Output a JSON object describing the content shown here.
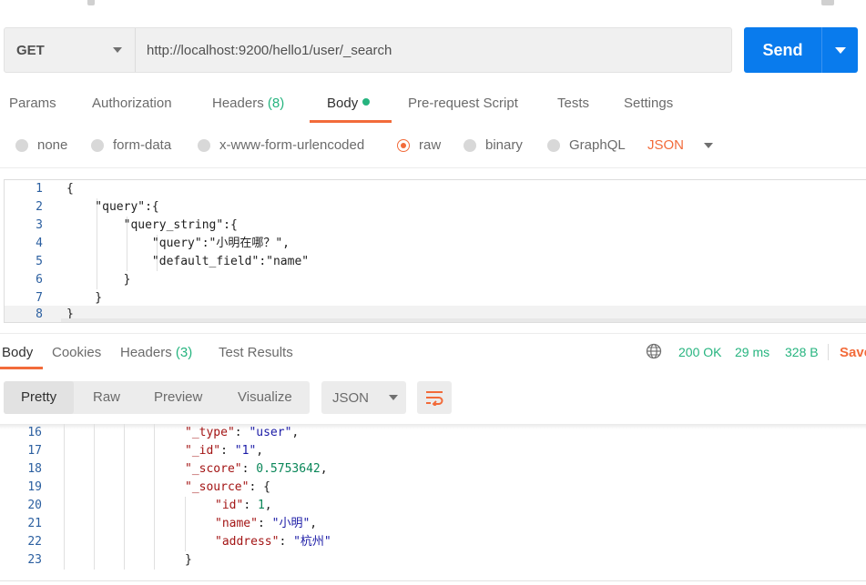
{
  "request": {
    "method": "GET",
    "url": "http://localhost:9200/hello1/user/_search",
    "send_label": "Send"
  },
  "request_tabs": [
    {
      "label": "Params"
    },
    {
      "label": "Authorization"
    },
    {
      "label": "Headers",
      "count": "(8)"
    },
    {
      "label": "Body",
      "active": true
    },
    {
      "label": "Pre-request Script"
    },
    {
      "label": "Tests"
    },
    {
      "label": "Settings"
    }
  ],
  "body_types": [
    {
      "label": "none"
    },
    {
      "label": "form-data"
    },
    {
      "label": "x-www-form-urlencoded"
    },
    {
      "label": "raw",
      "selected": true
    },
    {
      "label": "binary"
    },
    {
      "label": "GraphQL"
    }
  ],
  "body_format": "JSON",
  "request_body": [
    {
      "n": "1",
      "text": "{"
    },
    {
      "n": "2",
      "text": "    \"query\":{"
    },
    {
      "n": "3",
      "text": "        \"query_string\":{"
    },
    {
      "n": "4",
      "text": "            \"query\":\"小明在哪？\","
    },
    {
      "n": "5",
      "text": "            \"default_field\":\"name\""
    },
    {
      "n": "6",
      "text": "        }"
    },
    {
      "n": "7",
      "text": "    }"
    },
    {
      "n": "8",
      "text": "}"
    }
  ],
  "response_tabs": [
    {
      "label": "Body",
      "active": true
    },
    {
      "label": "Cookies"
    },
    {
      "label": "Headers",
      "count": "(3)"
    },
    {
      "label": "Test Results"
    }
  ],
  "response_status": {
    "code": "200 OK",
    "time": "29 ms",
    "size": "328 B",
    "save_label": "Save"
  },
  "response_views": [
    "Pretty",
    "Raw",
    "Preview",
    "Visualize"
  ],
  "response_format": "JSON",
  "response_body": [
    {
      "n": "16",
      "key": "\"_type\"",
      "val": "\"user\"",
      "vtype": "str",
      "comma": ","
    },
    {
      "n": "17",
      "key": "\"_id\"",
      "val": "\"1\"",
      "vtype": "str",
      "comma": ","
    },
    {
      "n": "18",
      "key": "\"_score\"",
      "val": "0.5753642",
      "vtype": "num",
      "comma": ","
    },
    {
      "n": "19",
      "key": "\"_source\"",
      "val": "{",
      "vtype": "plain",
      "comma": ""
    },
    {
      "n": "20",
      "key": "\"id\"",
      "val": "1",
      "vtype": "num",
      "comma": ","
    },
    {
      "n": "21",
      "key": "\"name\"",
      "val": "\"小明\"",
      "vtype": "str",
      "comma": ","
    },
    {
      "n": "22",
      "key": "\"address\"",
      "val": "\"杭州\"",
      "vtype": "str",
      "comma": ""
    },
    {
      "n": "23",
      "key": "",
      "val": "}",
      "vtype": "plain",
      "comma": ""
    }
  ],
  "colors": {
    "accent": "#f26b3a",
    "primary": "#097bed",
    "success": "#26b47f"
  }
}
